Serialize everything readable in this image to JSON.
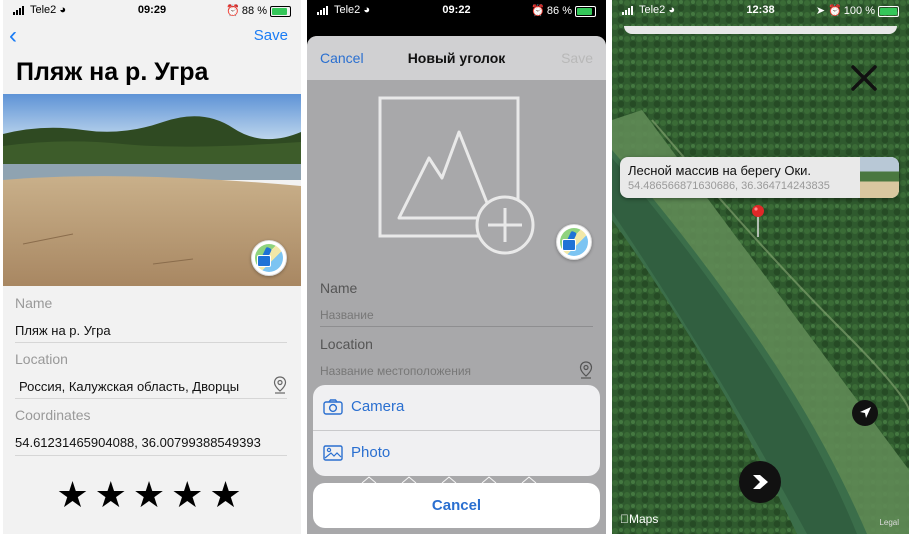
{
  "screen1": {
    "status": {
      "carrier": "Tele2",
      "time": "09:29",
      "battery": "88 %",
      "battery_level": 0.88
    },
    "save": "Save",
    "title": "Пляж на р. Угра",
    "name_label": "Name",
    "name_value": "Пляж на р. Угра",
    "location_label": "Location",
    "location_value": "Россия, Калужская область, Дворцы",
    "coordinates_label": "Coordinates",
    "coordinates_value": "54.61231465904088, 36.00799388549393",
    "rating": 5,
    "stars": "★★★★★"
  },
  "screen2": {
    "status": {
      "carrier": "Tele2",
      "time": "09:22",
      "battery": "86 %",
      "battery_level": 0.86
    },
    "cancel": "Cancel",
    "title": "Новый уголок",
    "save": "Save",
    "name_label": "Name",
    "name_placeholder": "Название",
    "location_label": "Location",
    "location_placeholder": "Название местоположения",
    "action_camera": "Camera",
    "action_photo": "Photo",
    "action_cancel": "Cancel"
  },
  "screen3": {
    "status": {
      "carrier": "Tele2",
      "time": "12:38",
      "battery": "100 %",
      "battery_level": 1.0
    },
    "callout_title": "Лесной массив на берегу Оки.",
    "callout_coords": "54.486566871630686, 36.364714243835",
    "maps_logo": "Maps",
    "legal": "Legal"
  },
  "colors": {
    "accent": "#1a7cf5",
    "pin": "#e02828",
    "battery": "#34c759"
  }
}
